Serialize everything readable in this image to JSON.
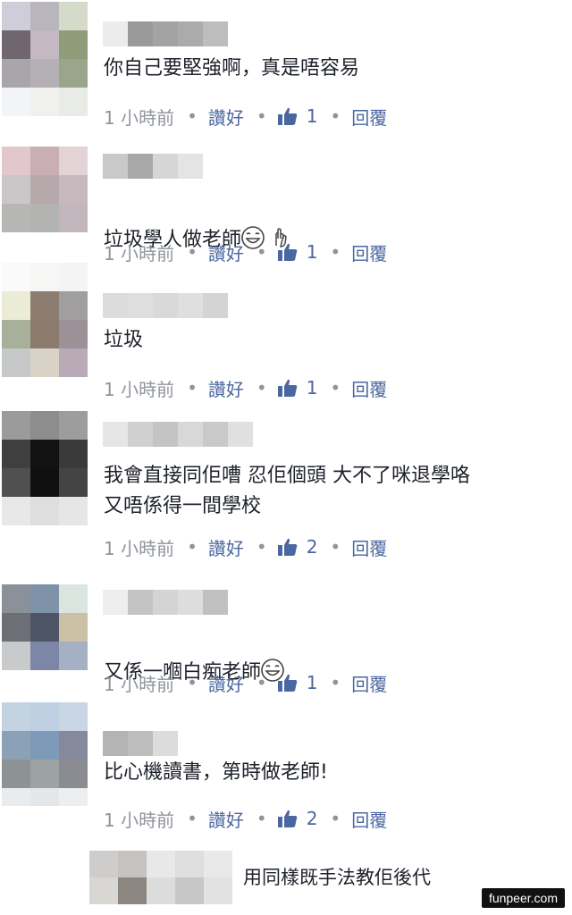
{
  "comments": [
    {
      "text": "你自己要堅強啊，真是唔容易",
      "time": "1 小時前",
      "like_label": "讚好",
      "likes": "1",
      "reply_label": "回覆"
    },
    {
      "text": "垃圾學人做老師",
      "time": "1 小時前",
      "like_label": "讚好",
      "likes": "1",
      "reply_label": "回覆"
    },
    {
      "text": "垃圾",
      "time": "1 小時前",
      "like_label": "讚好",
      "likes": "1",
      "reply_label": "回覆"
    },
    {
      "text": "我會直接同佢嘈 忍佢個頭 大不了咪退學咯\n又唔係得一間學校",
      "time": "1 小時前",
      "like_label": "讚好",
      "likes": "2",
      "reply_label": "回覆"
    },
    {
      "text": "又係一嗰白痴老師",
      "time": "1 小時前",
      "like_label": "讚好",
      "likes": "1",
      "reply_label": "回覆"
    },
    {
      "text": "比心機讀書，第時做老師!",
      "time": "1 小時前",
      "like_label": "讚好",
      "likes": "2",
      "reply_label": "回覆"
    }
  ],
  "reply_input": {
    "text": "用同樣既手法教佢後代"
  },
  "watermark": "funpeer.com",
  "colors": {
    "link": "#4b67a1",
    "meta": "#90949c",
    "text": "#1d2129"
  }
}
